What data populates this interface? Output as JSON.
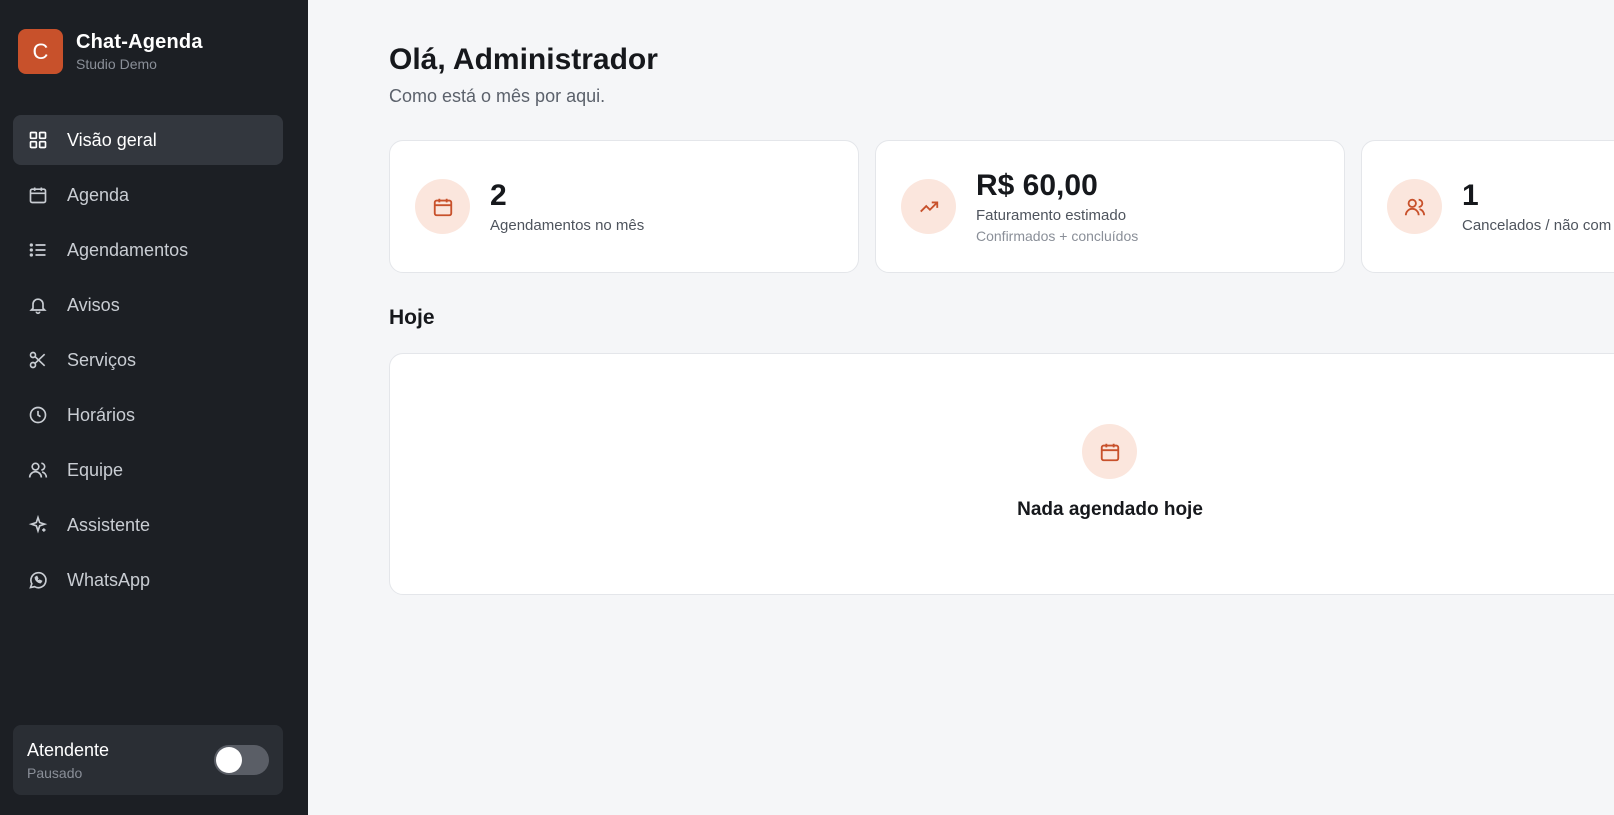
{
  "brand": {
    "logo_letter": "C",
    "title": "Chat-Agenda",
    "subtitle": "Studio Demo"
  },
  "nav": [
    {
      "label": "Visão geral",
      "icon": "grid-icon",
      "active": true
    },
    {
      "label": "Agenda",
      "icon": "calendar-icon"
    },
    {
      "label": "Agendamentos",
      "icon": "list-icon"
    },
    {
      "label": "Avisos",
      "icon": "bell-icon"
    },
    {
      "label": "Serviços",
      "icon": "scissors-icon"
    },
    {
      "label": "Horários",
      "icon": "clock-icon"
    },
    {
      "label": "Equipe",
      "icon": "users-icon"
    },
    {
      "label": "Assistente",
      "icon": "sparkle-icon"
    },
    {
      "label": "WhatsApp",
      "icon": "whatsapp-icon"
    }
  ],
  "attendant": {
    "title": "Atendente",
    "status": "Pausado",
    "enabled": false
  },
  "header": {
    "greeting": "Olá, Administrador",
    "subtitle": "Como está o mês por aqui."
  },
  "stats": [
    {
      "value": "2",
      "label": "Agendamentos no mês",
      "icon": "calendar-icon"
    },
    {
      "value": "R$ 60,00",
      "label": "Faturamento estimado",
      "hint": "Confirmados + concluídos",
      "icon": "trending-up-icon"
    },
    {
      "value": "1",
      "label": "Cancelados / não com",
      "icon": "users-icon"
    }
  ],
  "today": {
    "title": "Hoje",
    "empty_text": "Nada agendado hoje"
  },
  "colors": {
    "accent": "#c8512b",
    "sidebar_bg": "#1c1f24",
    "icon_bg": "#fbe6dd"
  }
}
